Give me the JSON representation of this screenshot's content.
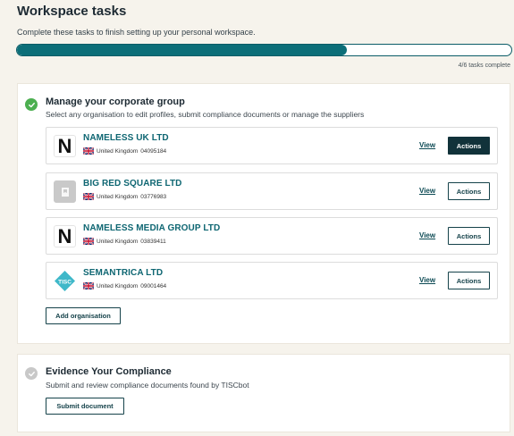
{
  "header": {
    "title": "Workspace tasks",
    "subtitle": "Complete these tasks to finish setting up your personal workspace.",
    "progress_fraction": 0.667,
    "progress_text": "4/6 tasks complete"
  },
  "colors": {
    "accent": "#0c6e78",
    "complete_check": "#4caf50",
    "pending_check": "#c8c8c8",
    "dark_button": "#11323a"
  },
  "tasks": [
    {
      "title": "Manage your corporate group",
      "description": "Select any organisation to edit profiles, submit compliance documents or manage the suppliers",
      "status": "complete",
      "check_icon": "check-icon",
      "organisations": [
        {
          "name": "NAMELESS UK LTD",
          "country": "United Kingdom",
          "number": "04095184",
          "logo": "letter-n-logo",
          "view_label": "View",
          "actions_label": "Actions",
          "actions_active": true
        },
        {
          "name": "BIG RED SQUARE LTD",
          "country": "United Kingdom",
          "number": "03776983",
          "logo": "placeholder-logo",
          "view_label": "View",
          "actions_label": "Actions",
          "actions_active": false
        },
        {
          "name": "NAMELESS MEDIA GROUP LTD",
          "country": "United Kingdom",
          "number": "03839411",
          "logo": "letter-n-logo",
          "view_label": "View",
          "actions_label": "Actions",
          "actions_active": false
        },
        {
          "name": "SEMANTRICA LTD",
          "country": "United Kingdom",
          "number": "09001464",
          "logo": "tisc-logo",
          "view_label": "View",
          "actions_label": "Actions",
          "actions_active": false
        }
      ],
      "add_button_label": "Add organisation"
    },
    {
      "title": "Evidence Your Compliance",
      "description": "Submit and review compliance documents found by TISCbot",
      "status": "incomplete",
      "check_icon": "check-icon",
      "button_label": "Submit document"
    }
  ]
}
